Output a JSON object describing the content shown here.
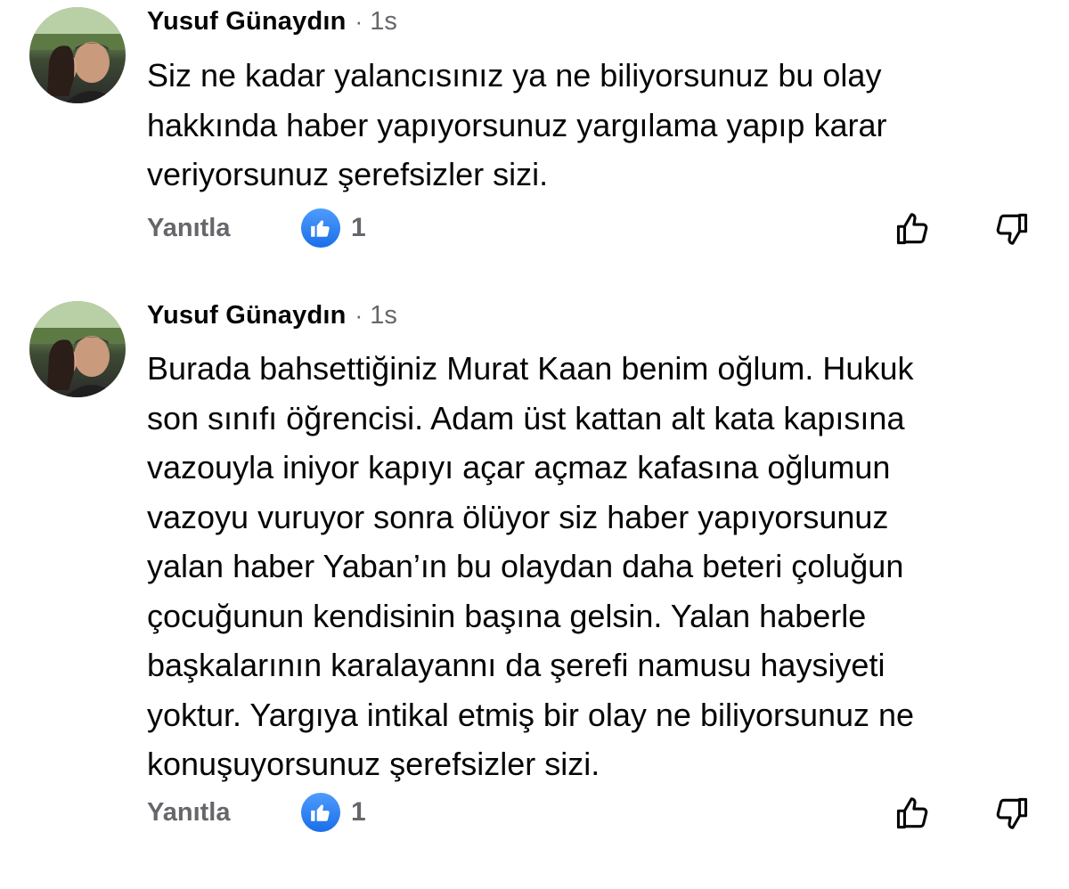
{
  "comments": [
    {
      "author": "Yusuf Günaydın",
      "separator": "·",
      "time": "1s",
      "text": "Siz ne kadar yalancısınız ya ne biliyorsunuz bu olay\nhakkında haber yapıyorsunuz yargılama yapıp karar\nveriyorsunuz şerefsizler sizi.",
      "reply_label": "Yanıtla",
      "reaction_count": "1"
    },
    {
      "author": "Yusuf Günaydın",
      "separator": "·",
      "time": "1s",
      "text": "Burada bahsettiğiniz Murat Kaan benim oğlum. Hukuk\nson sınıfı öğrencisi. Adam üst kattan alt kata kapısına\nvazouyla iniyor kapıyı açar açmaz kafasına oğlumun\nvazoyu vuruyor sonra ölüyor siz haber yapıyorsunuz\nyalan haber Yaban’ın bu olaydan daha beteri çoluğun\nçocuğunun kendisinin başına gelsin. Yalan haberle\nbaşkalarının karalayannı da şerefi namusu haysiyeti\nyoktur. Yargıya intikal etmiş bir olay ne biliyorsunuz ne\nkonuşuyorsunuz şerefsizler sizi.",
      "reply_label": "Yanıtla",
      "reaction_count": "1"
    }
  ],
  "icons": {
    "reaction": "like-reaction-icon",
    "upvote": "thumbs-up-outline-icon",
    "downvote": "thumbs-down-outline-icon"
  },
  "colors": {
    "text": "#050505",
    "secondary": "#65676b",
    "like_blue": "#1877f2"
  }
}
